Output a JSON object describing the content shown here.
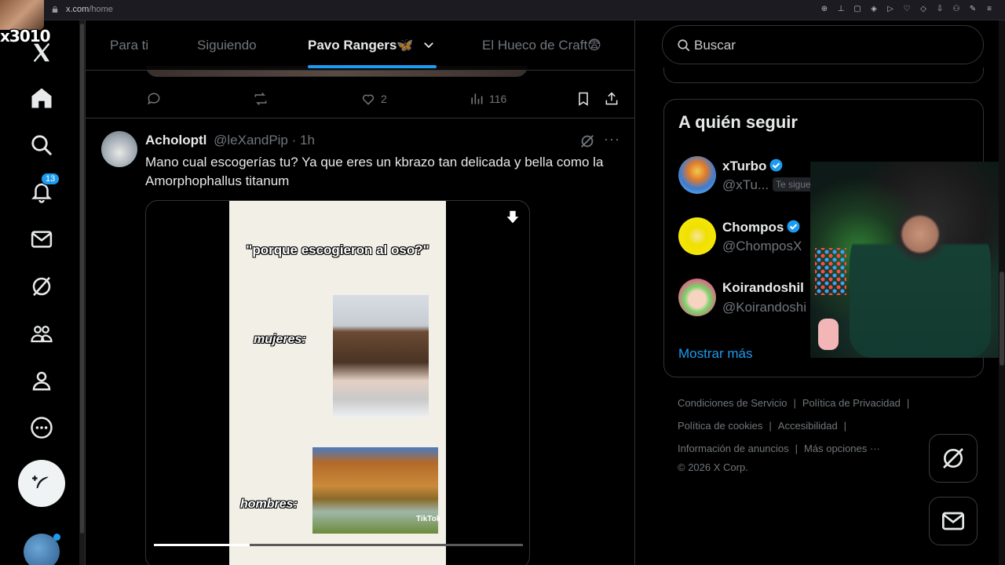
{
  "browser": {
    "url_host": "x.com",
    "url_path": "/home"
  },
  "streamer": {
    "tag": "x3010"
  },
  "nav": {
    "notifications_badge": "13"
  },
  "tabs": [
    {
      "label": "Para ti"
    },
    {
      "label": "Siguiendo"
    },
    {
      "label": "Pavo Rangers🦋"
    },
    {
      "label": "El Hueco de Craft😨"
    }
  ],
  "prev_tweet_actions": {
    "likes": "2",
    "views": "116"
  },
  "tweet": {
    "name": "Acholoptl",
    "handle": "@leXandPip · 1h",
    "text": "Mano cual escogerías tu? Ya que eres un kbrazo tan delicada y bella como la Amorphophallus titanum",
    "video": {
      "title": "\"porque escogieron al oso?\"",
      "label_women": "mujeres:",
      "label_men": "hombres:",
      "watermark": "TikTok",
      "progress": 0.26
    }
  },
  "search": {
    "placeholder": "Buscar"
  },
  "who_to_follow": {
    "title": "A quién seguir",
    "accounts": [
      {
        "name": "xTurbo",
        "handle": "@xTu...",
        "follows_you": "Te sigue",
        "verified": true
      },
      {
        "name": "Chompos",
        "handle": "@ChomposX",
        "verified": true
      },
      {
        "name": "Koirandoshil",
        "handle": "@Koirandoshi",
        "verified": false
      }
    ],
    "show_more": "Mostrar más"
  },
  "footer": {
    "terms": "Condiciones de Servicio",
    "privacy": "Política de Privacidad",
    "cookies": "Política de cookies",
    "accessibility": "Accesibilidad",
    "ads_info": "Información de anuncios",
    "more": "Más opciones ···",
    "copyright": "© 2026 X Corp."
  },
  "colors": {
    "accent": "#1d9bf0",
    "background": "#000000",
    "text": "#e7e9ea",
    "muted": "#71767b"
  }
}
